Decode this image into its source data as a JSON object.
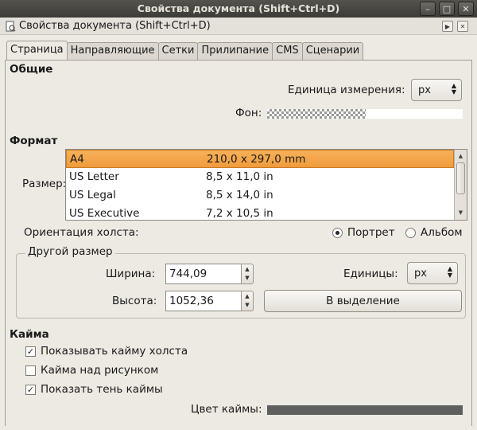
{
  "window": {
    "title": "Свойства документа (Shift+Ctrl+D)",
    "buttons": [
      "–",
      "□",
      "✕"
    ]
  },
  "dock": {
    "title": "Свойства документа (Shift+Ctrl+D)",
    "icon": "document-properties-icon"
  },
  "tabs": [
    {
      "label": "Страница",
      "active": true
    },
    {
      "label": "Направляющие",
      "active": false
    },
    {
      "label": "Сетки",
      "active": false
    },
    {
      "label": "Прилипание",
      "active": false
    },
    {
      "label": "CMS",
      "active": false
    },
    {
      "label": "Сценарии",
      "active": false
    }
  ],
  "general": {
    "heading": "Общие",
    "unit_label": "Единица измерения:",
    "unit_value": "px",
    "background_label": "Фон:"
  },
  "format": {
    "heading": "Формат",
    "size_label": "Размер:",
    "sizes": [
      {
        "name": "A4",
        "dims": "210,0 x 297,0 mm",
        "selected": true
      },
      {
        "name": "US Letter",
        "dims": "8,5 x 11,0 in",
        "selected": false
      },
      {
        "name": "US Legal",
        "dims": "8,5 x 14,0 in",
        "selected": false
      },
      {
        "name": "US Executive",
        "dims": "7,2 x 10,5 in",
        "selected": false
      }
    ],
    "orientation_label": "Ориентация холста:",
    "portrait_label": "Портрет",
    "landscape_label": "Альбом",
    "orientation": "portrait"
  },
  "custom_size": {
    "heading": "Другой размер",
    "width_label": "Ширина:",
    "width_value": "744,09",
    "height_label": "Высота:",
    "height_value": "1052,36",
    "units_label": "Единицы:",
    "units_value": "px",
    "fit_button": "В выделение"
  },
  "border": {
    "heading": "Кайма",
    "show_border": {
      "label": "Показывать кайму холста",
      "checked": true
    },
    "border_on_top": {
      "label": "Кайма над рисунком",
      "checked": false
    },
    "show_shadow": {
      "label": "Показать тень каймы",
      "checked": true
    },
    "color_label": "Цвет каймы:",
    "color": "#5f5f5f"
  }
}
